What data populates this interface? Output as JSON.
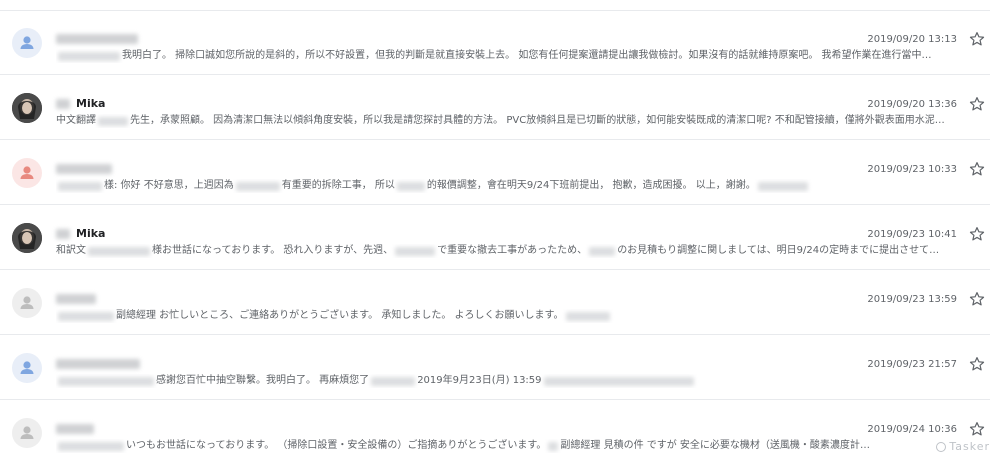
{
  "messages": [
    {
      "avatar": "person-icon",
      "avatar_style": "blue",
      "sender_name": "",
      "date": "2019/09/20 13:13",
      "snippet": "我明白了。 掃除口誠如您所說的是斜的，所以不好設置，但我的判斷是就直接安裝上去。 如您有任何提案還請提出讓我做檢討。如果沒有的話就維持原案吧。 我希望作業在進行當中",
      "snippet_tail": "…"
    },
    {
      "avatar": "photo-avatar",
      "avatar_style": "photo",
      "sender_name": "Mika",
      "date": "2019/09/20 13:36",
      "snippet_prefix": "中文翻譯",
      "snippet": "先生，承蒙照顧。 因為清潔口無法以傾斜角度安裝，所以我是請您探討具體的方法。 PVC放傾斜且是已切斷的狀態，如何能安裝既成的清潔口呢? 不和配管接續，僅將外觀表面用水泥",
      "snippet_tail": "…"
    },
    {
      "avatar": "person-icon",
      "avatar_style": "red",
      "sender_name": "",
      "date": "2019/09/23 10:33",
      "snippet": "樣: 你好 不好意思，上週因為",
      "snippet_mid": "有重要的拆除工事， 所以",
      "snippet_mid2": "的報價調整，會在明天9/24下班前提出， 抱歉，造成困擾。 以上，謝謝。",
      "snippet_tail": ""
    },
    {
      "avatar": "photo-avatar",
      "avatar_style": "photo",
      "sender_name": "Mika",
      "date": "2019/09/23 10:41",
      "snippet_prefix": "和訳文",
      "snippet": "様お世話になっております。 恐れ入りますが、先週、",
      "snippet_mid": "で重要な撤去工事があったため、",
      "snippet_mid2": "のお見積もり調整に関しましては、明日9/24の定時までに提出させて",
      "snippet_tail": "…"
    },
    {
      "avatar": "person-icon",
      "avatar_style": "gray",
      "sender_name": "",
      "date": "2019/09/23 13:59",
      "snippet": "副總經理 お忙しいところ、ご連絡ありがとうございます。 承知しました。 よろしくお願いします。",
      "snippet_tail": ""
    },
    {
      "avatar": "person-icon",
      "avatar_style": "blue",
      "sender_name": "",
      "date": "2019/09/23 21:57",
      "snippet": "感謝您百忙中抽空聯繫。我明白了。 再麻煩您了",
      "snippet_mid": "2019年9月23日(月) 13:59",
      "snippet_mid2": "",
      "snippet_tail": ""
    },
    {
      "avatar": "person-icon",
      "avatar_style": "gray",
      "sender_name": "",
      "date": "2019/09/24 10:36",
      "snippet": "いつもお世話になっております。 （掃除口設置・安全設備の）ご指摘ありがとうございます。",
      "snippet_mid": "副總經理 見積の件 ですが 安全に必要な機材（送風機・酸素濃度計",
      "snippet_mid2": "",
      "snippet_tail": "…"
    }
  ],
  "icons": {
    "star": "star-outline-icon",
    "person": "person-icon"
  },
  "colors": {
    "person_blue": "#7fa6e0",
    "person_red": "#e8897f",
    "person_gray": "#bdbdbd"
  },
  "watermark": "Tasker"
}
